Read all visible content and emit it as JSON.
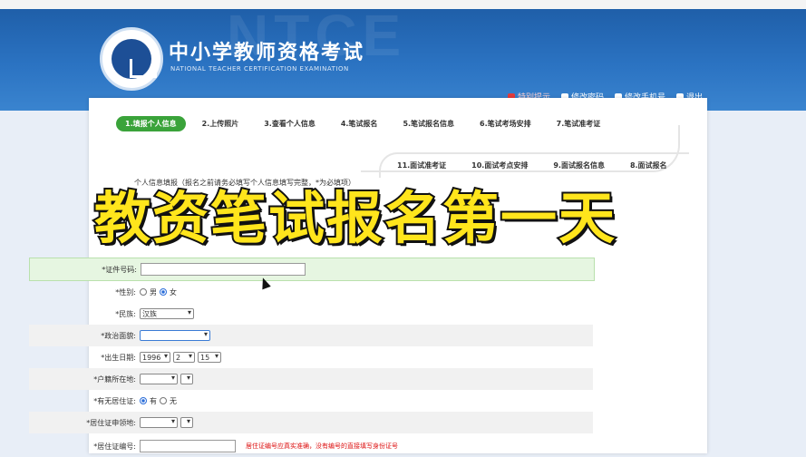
{
  "header": {
    "title": "中小学教师资格考试",
    "subtitle": "NATIONAL TEACHER CERTIFICATION EXAMINATION",
    "watermark": "NTCE",
    "links": [
      {
        "label": "特别提示",
        "icon": "warning-icon"
      },
      {
        "label": "修改密码",
        "icon": "key-icon"
      },
      {
        "label": "修改手机号",
        "icon": "phone-icon"
      },
      {
        "label": "退出",
        "icon": "logout-icon"
      }
    ]
  },
  "steps_row1": [
    "1.填报个人信息",
    "2.上传照片",
    "3.查看个人信息",
    "4.笔试报名",
    "5.笔试报名信息",
    "6.笔试考场安排",
    "7.笔试准考证"
  ],
  "steps_row2": [
    "11.面试准考证",
    "10.面试考点安排",
    "9.面试报名信息",
    "8.面试报名"
  ],
  "section_title": "个人信息填报（报名之前请务必填写个人信息填写完整，*为必填项）",
  "form": {
    "id_label": "*证件号码:",
    "gender_label": "*性别:",
    "gender_male": "男",
    "gender_female": "女",
    "ethnicity_label": "*民族:",
    "ethnicity_value": "汉族",
    "political_label": "*政治面貌:",
    "birth_label": "*出生日期:",
    "birth_year": "1996",
    "birth_month": "2",
    "birth_day": "15",
    "household_label": "*户籍所在地:",
    "residence_permit_label": "*有无居住证:",
    "residence_yes": "有",
    "residence_no": "无",
    "permit_issue_label": "*居住证申领地:",
    "permit_no_label": "*居住证编号:",
    "permit_note": "居住证编号应真实准确，没有编号的直接填写身份证号"
  },
  "overlay_caption": "教资笔试报名第一天",
  "colors": {
    "header_blue": "#2b73c2",
    "active_step": "#3aa33a",
    "caption_fill": "#ffe51c"
  }
}
